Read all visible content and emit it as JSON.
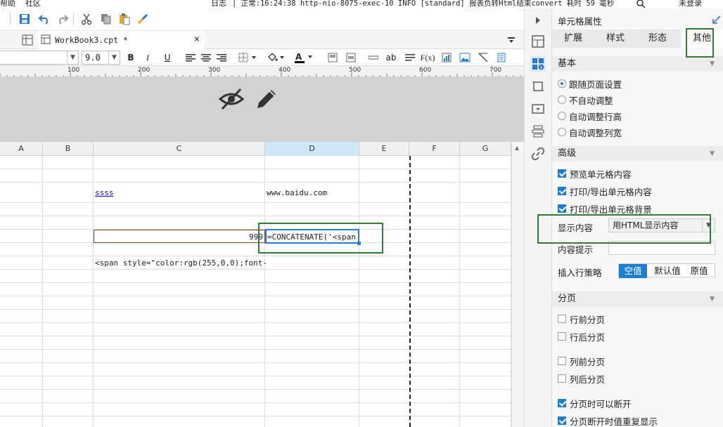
{
  "menubar": {
    "help": "帮助",
    "community": "社区",
    "log": "日志",
    "log_message": "| 正常:16:24:38 http-nio-8075-exec-10 INFO [standard] 报表负转Html结束convert  耗时 59 毫秒",
    "login": "未登录"
  },
  "tab": {
    "title": "WorkBook3.cpt *",
    "close": "×"
  },
  "format": {
    "font_size": "9.0",
    "bold": "B",
    "italic": "I",
    "underline": "U",
    "text_tool": "ab",
    "formula_tool": "F(x)"
  },
  "ruler": {
    "labels": [
      "100",
      "200",
      "300",
      "400",
      "500",
      "600",
      "700"
    ]
  },
  "columns": [
    "A",
    "B",
    "C",
    "D",
    "E",
    "F",
    "G"
  ],
  "cells": {
    "c_link": "ssss",
    "d_url": "www.baidu.com",
    "c_number": "999",
    "d_formula": "=CONCATENATE('<span",
    "c_html": "<span style=\"color:rgb(255,0,0);font-"
  },
  "panel": {
    "title": "单元格属性",
    "tabs": [
      "扩展",
      "样式",
      "形态",
      "其他"
    ],
    "sections": {
      "basic": "基本",
      "advanced": "高级",
      "paging": "分页"
    },
    "basic_options": [
      "跟随页面设置",
      "不自动调整",
      "自动调整行高",
      "自动调整列宽"
    ],
    "advanced_options": [
      "预览单元格内容",
      "打印/导出单元格内容",
      "打印/导出单元格背景"
    ],
    "display_label": "显示内容",
    "display_value": "用HTML显示内容",
    "tooltip_label": "内容提示",
    "insert_label": "插入行策略",
    "insert_options": [
      "空值",
      "默认值",
      "原值"
    ],
    "paging_options": [
      "行前分页",
      "行后分页",
      "列前分页",
      "列后分页"
    ],
    "paging_break_options": [
      "分页时可以断开",
      "分页断开时值重复显示"
    ]
  },
  "colors": {
    "accent": "#1b7fd1",
    "highlight": "#2e7d32",
    "link": "#1a0dab"
  }
}
